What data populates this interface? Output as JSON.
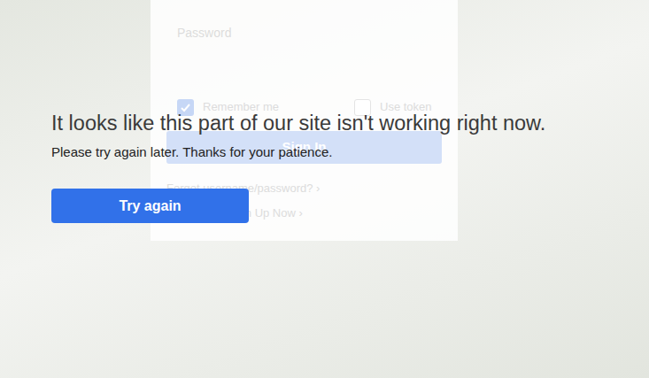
{
  "login_form": {
    "password_label": "Password",
    "remember_me": {
      "label": "Remember me",
      "checked": true
    },
    "use_token": {
      "label": "Use token",
      "checked": false
    },
    "sign_in_button": "Sign In",
    "forgot_link": "Forgot username/password? ›",
    "signup_link": "Sign Up Now ›"
  },
  "error": {
    "heading": "It looks like this part of our site isn't working right now.",
    "message": "Please try again later. Thanks for your patience.",
    "button": "Try again"
  }
}
